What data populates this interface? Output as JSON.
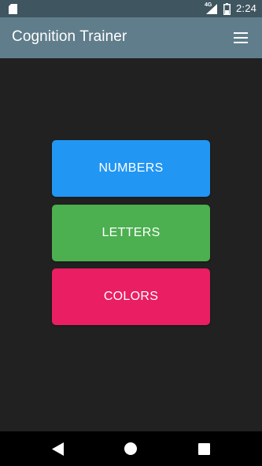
{
  "status_bar": {
    "network_label": "4G",
    "time": "2:24"
  },
  "app_bar": {
    "title": "Cognition Trainer",
    "menu_icon": "hamburger-menu-icon"
  },
  "modes": [
    {
      "label": "NUMBERS",
      "color": "#2196f3"
    },
    {
      "label": "LETTERS",
      "color": "#4caf50"
    },
    {
      "label": "COLORS",
      "color": "#e91e63"
    }
  ],
  "colors": {
    "background": "#212121",
    "app_bar": "#607d8b",
    "status_bar": "#3f5660"
  },
  "nav_bar": {
    "icons": [
      "back-icon",
      "home-icon",
      "recents-icon"
    ]
  }
}
